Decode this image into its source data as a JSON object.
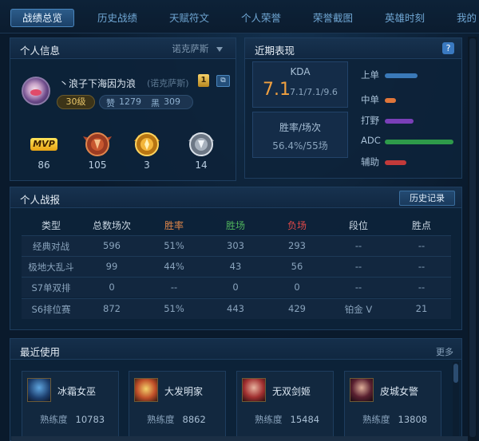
{
  "tabs": [
    {
      "label": "战绩总览",
      "active": true
    },
    {
      "label": "历史战绩",
      "active": false
    },
    {
      "label": "天赋符文",
      "active": false
    },
    {
      "label": "个人荣誉",
      "active": false
    },
    {
      "label": "荣誉截图",
      "active": false
    },
    {
      "label": "英雄时刻",
      "active": false
    },
    {
      "label": "我的",
      "active": false
    }
  ],
  "profile": {
    "title": "个人信息",
    "server_selector": "诺克萨斯",
    "summoner_name": "丶浪子下海因为浪",
    "server_paren": "(诺克萨斯)",
    "gold_badge": "1",
    "level": "30级",
    "praise_label": "赞",
    "praise_count": "1279",
    "black_label": "黑",
    "black_count": "309",
    "medals": [
      {
        "icon": "mvp-icon",
        "text": "MVP",
        "count": "86"
      },
      {
        "icon": "bronze-medal-icon",
        "count": "105"
      },
      {
        "icon": "gold-medal-icon",
        "count": "3"
      },
      {
        "icon": "silver-medal-icon",
        "count": "14"
      }
    ]
  },
  "recent": {
    "title": "近期表现",
    "help_icon": "?",
    "kda_label": "KDA",
    "kda_value": "7.1",
    "kda_detail": "7.1/7.1/9.6",
    "winrate_label": "胜率/场次",
    "winrate_value": "56.4%/55场",
    "roles": [
      {
        "label": "上单",
        "level": 0.45,
        "color": "#3a79b8"
      },
      {
        "label": "中单",
        "level": 0.16,
        "color": "#e0763a"
      },
      {
        "label": "打野",
        "level": 0.4,
        "color": "#7a3fb8"
      },
      {
        "label": "ADC",
        "level": 0.95,
        "color": "#2e9a4a"
      },
      {
        "label": "辅助",
        "level": 0.3,
        "color": "#c23a3a"
      }
    ]
  },
  "stats": {
    "title": "个人战报",
    "history_button": "历史记录",
    "headers": [
      {
        "label": "类型",
        "color": "#c9d6e2"
      },
      {
        "label": "总数场次",
        "color": "#c9d6e2"
      },
      {
        "label": "胜率",
        "color": "#e0874a"
      },
      {
        "label": "胜场",
        "color": "#4fb35c"
      },
      {
        "label": "负场",
        "color": "#e04848"
      },
      {
        "label": "段位",
        "color": "#c9d6e2"
      },
      {
        "label": "胜点",
        "color": "#c9d6e2"
      }
    ],
    "rows": [
      [
        "经典对战",
        "596",
        "51%",
        "303",
        "293",
        "--",
        "--"
      ],
      [
        "极地大乱斗",
        "99",
        "44%",
        "43",
        "56",
        "--",
        "--"
      ],
      [
        "S7单双排",
        "0",
        "--",
        "0",
        "0",
        "--",
        "--"
      ],
      [
        "S6排位赛",
        "872",
        "51%",
        "443",
        "429",
        "铂金 V",
        "21"
      ]
    ]
  },
  "recent_used": {
    "title": "最近使用",
    "more": "更多",
    "mastery_label": "熟练度",
    "champions": [
      {
        "name": "冰霜女巫",
        "mastery": "10783",
        "icon": "lissandra-portrait"
      },
      {
        "name": "大发明家",
        "mastery": "8862",
        "icon": "heimerdinger-portrait"
      },
      {
        "name": "无双剑姬",
        "mastery": "15484",
        "icon": "fiora-portrait"
      },
      {
        "name": "皮城女警",
        "mastery": "13808",
        "icon": "caitlyn-portrait"
      }
    ]
  }
}
